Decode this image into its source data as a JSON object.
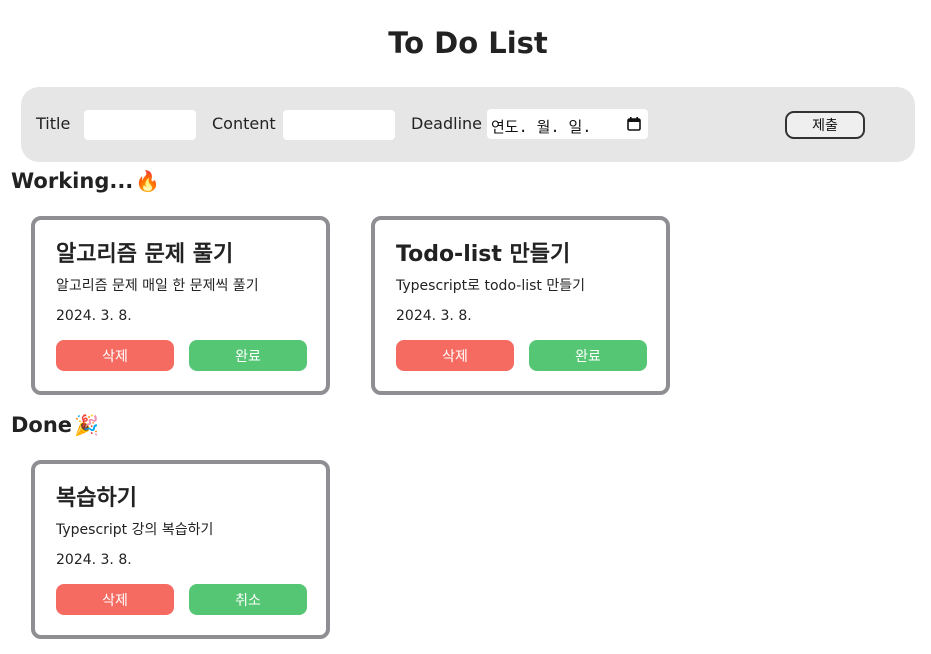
{
  "header": {
    "title": "To Do List"
  },
  "form": {
    "title_label": "Title",
    "title_value": "",
    "content_label": "Content",
    "content_value": "",
    "deadline_label": "Deadline",
    "deadline_placeholder": "연도. 월. 일.",
    "submit_label": "제출"
  },
  "sections": {
    "working": {
      "title": "Working...",
      "emoji": "🔥"
    },
    "done": {
      "title": "Done",
      "emoji": "🎉"
    }
  },
  "working_cards": [
    {
      "title": "알고리즘 문제 풀기",
      "content": "알고리즘 문제 매일 한 문제씩 풀기",
      "date": "2024. 3. 8.",
      "delete_label": "삭제",
      "toggle_label": "완료"
    },
    {
      "title": "Todo-list 만들기",
      "content": "Typescript로 todo-list 만들기",
      "date": "2024. 3. 8.",
      "delete_label": "삭제",
      "toggle_label": "완료"
    }
  ],
  "done_cards": [
    {
      "title": "복습하기",
      "content": "Typescript 강의 복습하기",
      "date": "2024. 3. 8.",
      "delete_label": "삭제",
      "toggle_label": "취소"
    }
  ],
  "colors": {
    "form_bg": "#e6e6e6",
    "card_border": "#8e8e93",
    "delete_button": "#f66b61",
    "complete_button": "#55c674"
  }
}
